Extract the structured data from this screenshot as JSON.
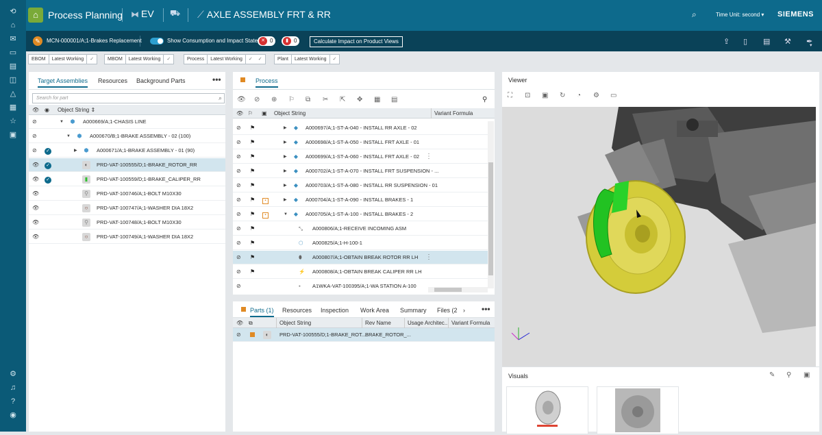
{
  "header": {
    "app_title": "Process Planning",
    "context": "EV",
    "product": "AXLE ASSEMBLY FRT & RR",
    "time_unit": "Time Unit: second",
    "brand": "SIEMENS"
  },
  "changebar": {
    "mcn": "MCN-000001/A;1-Brakes Replacement",
    "toggle_label": "Show Consumption and Impact State",
    "count_a": "0",
    "count_b": "0",
    "calc_button": "Calculate Impact on Product Views"
  },
  "contexts": [
    {
      "name": "EBOM",
      "rule": "Latest Working"
    },
    {
      "name": "MBOM",
      "rule": "Latest Working"
    },
    {
      "name": "Process",
      "rule": "Latest Working"
    },
    {
      "name": "Plant",
      "rule": "Latest Working"
    }
  ],
  "left_panel": {
    "tabs": [
      "Target Assemblies",
      "Resources",
      "Background Parts"
    ],
    "more": "•••",
    "search_placeholder": "Search for part",
    "col_object": "Object String",
    "rows": [
      {
        "label": "A000669/A;1-CHASIS LINE"
      },
      {
        "label": "A000670/B;1-BRAKE ASSEMBLY - 02 (100)"
      },
      {
        "label": "A000671/A;1-BRAKE ASSEMBLY - 01 (90)"
      },
      {
        "label": "PRD-VAT-100555/D;1-BRAKE_ROTOR_RR"
      },
      {
        "label": "PRD-VAT-100559/D;1-BRAKE_CALIPER_RR"
      },
      {
        "label": "PRD-VAT-100746/A;1-BOLT M10X30"
      },
      {
        "label": "PRD-VAT-100747/A;1-WASHER DIA 18X2"
      },
      {
        "label": "PRD-VAT-100748/A;1-BOLT M10X30"
      },
      {
        "label": "PRD-VAT-100749/A;1-WASHER DIA 18X2"
      }
    ]
  },
  "process_panel": {
    "tab": "Process",
    "col_object": "Object String",
    "col_variant": "Variant Formula",
    "rows": [
      {
        "label": "A000697/A;1-ST-A-040 - INSTALL RR AXLE - 02"
      },
      {
        "label": "A000698/A;1-ST-A-050 - INSTALL FRT AXLE - 01"
      },
      {
        "label": "A000699/A;1-ST-A-060 - INSTALL FRT AXLE - 02"
      },
      {
        "label": "A000702/A;1-ST-A-070 - INSTALL FRT SUSPENSION - ..."
      },
      {
        "label": "A000703/A;1-ST-A-080 - INSTALL RR SUSPENSION - 01"
      },
      {
        "label": "A000704/A;1-ST-A-090 - INSTALL BRAKES - 1"
      },
      {
        "label": "A000705/A;1-ST-A-100 - INSTALL BRAKES - 2"
      },
      {
        "label": "A000806/A;1-RECEIVE INCOMING ASM"
      },
      {
        "label": "A000825/A;1-H-100-1"
      },
      {
        "label": "A000807/A;1-OBTAIN BREAK ROTOR RR LH"
      },
      {
        "label": "A000808/A;1-OBTAIN BREAK CALIPER RR LH"
      },
      {
        "label": "A1WKA-VAT-100395/A;1-WA STATION A-100"
      }
    ]
  },
  "parts_panel": {
    "tabs": [
      "Parts (1)",
      "Resources",
      "Inspection",
      "Work Area",
      "Summary",
      "Files (2"
    ],
    "more": "•••",
    "cols": [
      "Object String",
      "Rev Name",
      "Usage Architec...",
      "Variant Formula"
    ],
    "rows": [
      {
        "object": "PRD-VAT-100555/D;1-BRAKE_ROT...",
        "rev": "BRAKE_ROTOR_..."
      }
    ]
  },
  "viewer": {
    "title": "Viewer",
    "visuals_title": "Visuals"
  },
  "colors": {
    "rail": "#0b5a77",
    "header": "#0d6a8c",
    "changebar": "#0a4258",
    "accent": "#0d6a8c",
    "selected_row": "#d2e5ee",
    "rotor": "#d9d04a",
    "caliper": "#22c222"
  }
}
